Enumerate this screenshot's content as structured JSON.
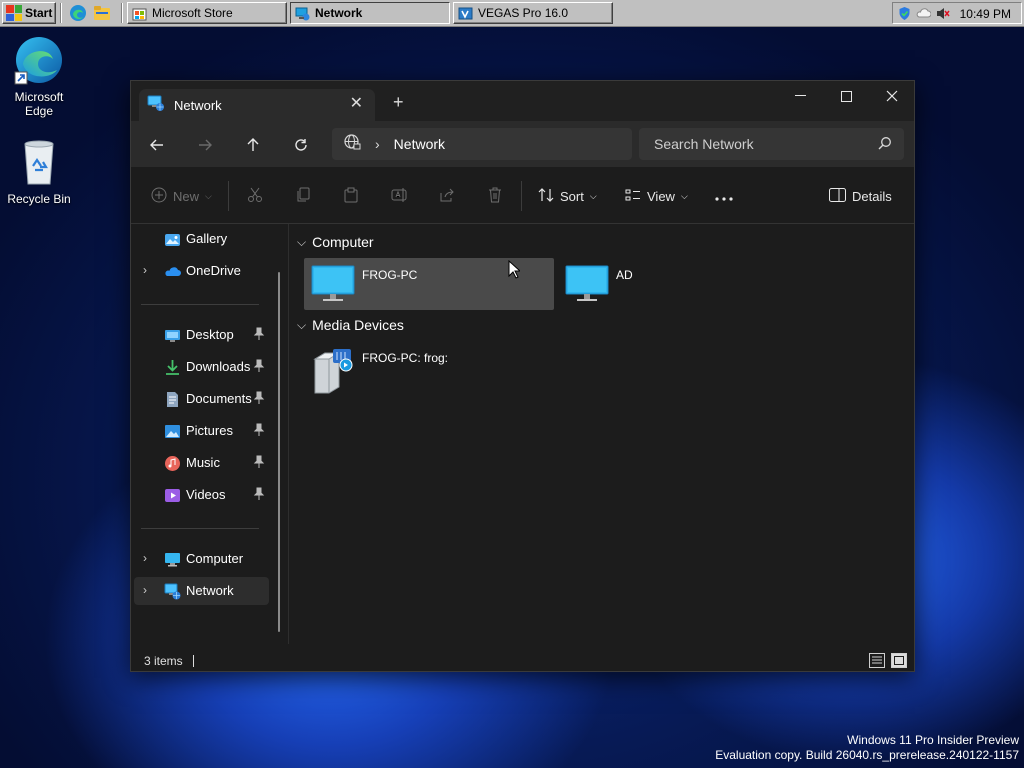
{
  "taskbar": {
    "start_label": "Start",
    "tasks": [
      {
        "label": "Microsoft Store"
      },
      {
        "label": "Network"
      },
      {
        "label": "VEGAS Pro 16.0"
      }
    ],
    "clock": "10:49 PM"
  },
  "desktop": {
    "icons": [
      {
        "label": "Microsoft Edge",
        "icon": "edge-icon"
      },
      {
        "label": "Recycle Bin",
        "icon": "recycle-bin-icon"
      }
    ],
    "watermark_line1": "Windows 11 Pro Insider Preview",
    "watermark_line2": "Evaluation copy. Build 26040.rs_prerelease.240122-1157"
  },
  "explorer": {
    "tab_title": "Network",
    "address": {
      "location": "Network"
    },
    "search": {
      "placeholder": "Search Network"
    },
    "commands": {
      "new": "New",
      "sort": "Sort",
      "view": "View",
      "details": "Details"
    },
    "sidebar": {
      "items": [
        {
          "label": "Gallery",
          "icon": "gallery-icon"
        },
        {
          "label": "OneDrive",
          "icon": "onedrive-icon"
        },
        {
          "label": "Desktop",
          "icon": "desktop-folder-icon",
          "pinned": true
        },
        {
          "label": "Downloads",
          "icon": "downloads-icon",
          "pinned": true
        },
        {
          "label": "Documents",
          "icon": "documents-icon",
          "pinned": true
        },
        {
          "label": "Pictures",
          "icon": "pictures-icon",
          "pinned": true
        },
        {
          "label": "Music",
          "icon": "music-icon",
          "pinned": true
        },
        {
          "label": "Videos",
          "icon": "videos-icon",
          "pinned": true
        },
        {
          "label": "Computer",
          "icon": "computer-icon"
        },
        {
          "label": "Network",
          "icon": "network-icon",
          "selected": true
        }
      ]
    },
    "groups": [
      {
        "title": "Computer",
        "items": [
          {
            "label": "FROG-PC",
            "selected": true
          },
          {
            "label": "AD"
          }
        ]
      },
      {
        "title": "Media Devices",
        "items": [
          {
            "label": "FROG-PC: frog:"
          }
        ]
      }
    ],
    "status": {
      "item_count": "3 items"
    }
  },
  "colors": {
    "accent": "#60cdff",
    "window_bg": "#1c1c1c",
    "toolbar_bg": "#2b2b2b",
    "selected_tile": "#4a4a4a",
    "taskbar_gray": "#c0c0c0"
  }
}
